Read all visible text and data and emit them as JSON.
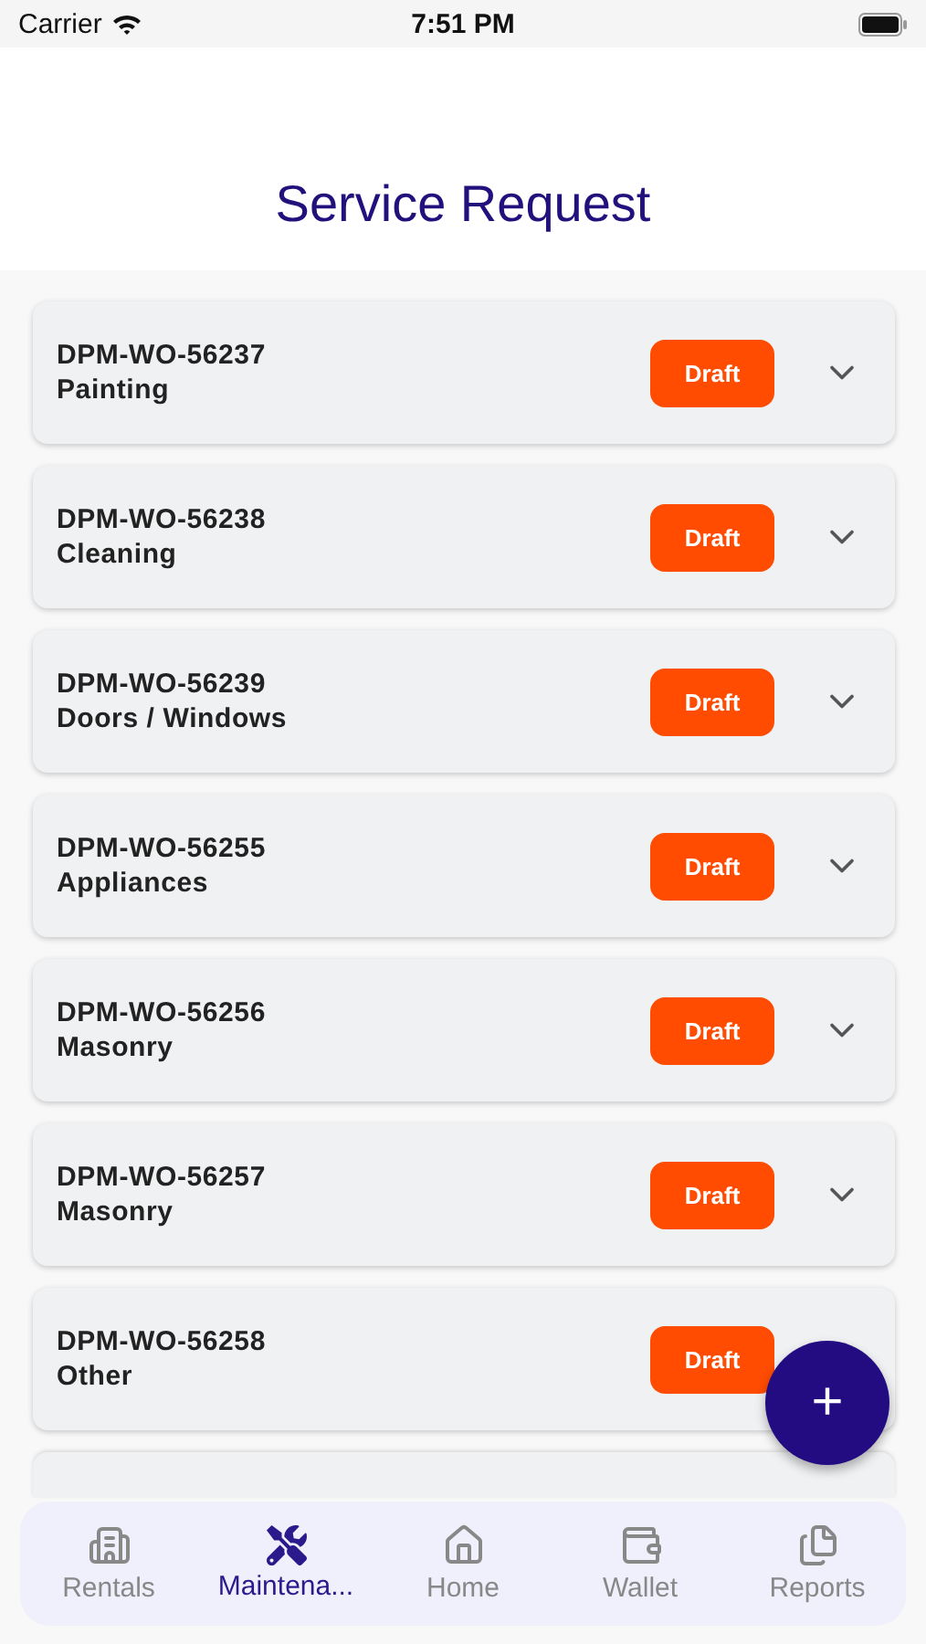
{
  "status_bar": {
    "carrier": "Carrier",
    "time": "7:51 PM"
  },
  "title": "Service Request",
  "requests": [
    {
      "kind": "full",
      "code": "DPM-WO-56237",
      "category": "Painting",
      "status": "Draft",
      "expanded": false
    },
    {
      "kind": "full",
      "code": "DPM-WO-56238",
      "category": "Cleaning",
      "status": "Draft",
      "expanded": false
    },
    {
      "kind": "full",
      "code": "DPM-WO-56239",
      "category": "Doors / Windows",
      "status": "Draft",
      "expanded": false
    },
    {
      "kind": "full",
      "code": "DPM-WO-56255",
      "category": "Appliances",
      "status": "Draft",
      "expanded": false
    },
    {
      "kind": "full",
      "code": "DPM-WO-56256",
      "category": "Masonry",
      "status": "Draft",
      "expanded": false
    },
    {
      "kind": "full",
      "code": "DPM-WO-56257",
      "category": "Masonry",
      "status": "Draft",
      "expanded": false
    },
    {
      "kind": "full",
      "code": "DPM-WO-56258",
      "category": "Other",
      "status": "Draft"
    },
    {
      "kind": "partial"
    }
  ],
  "fab": {
    "label": "+"
  },
  "tabs": [
    {
      "label": "Rentals",
      "selected": false
    },
    {
      "label": "Maintena...",
      "selected": true
    },
    {
      "label": "Home",
      "selected": false
    },
    {
      "label": "Wallet",
      "selected": false
    },
    {
      "label": "Reports",
      "selected": false
    }
  ]
}
